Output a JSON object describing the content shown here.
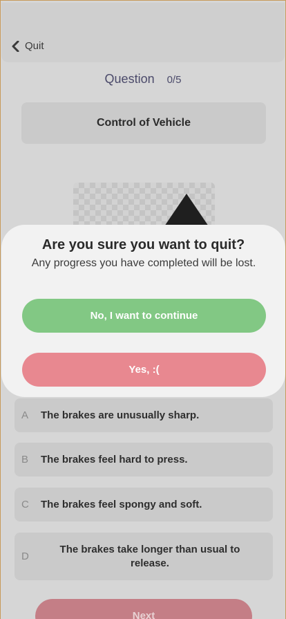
{
  "header": {
    "quit_label": "Quit"
  },
  "progress": {
    "label": "Question",
    "value": "0/5"
  },
  "category": "Control of Vehicle",
  "answers": [
    {
      "letter": "A",
      "text": "The brakes are unusually sharp."
    },
    {
      "letter": "B",
      "text": "The brakes feel hard to press."
    },
    {
      "letter": "C",
      "text": "The brakes feel spongy and soft."
    },
    {
      "letter": "D",
      "text": "The brakes take longer than usual to release."
    }
  ],
  "next_label": "Next",
  "modal": {
    "title": "Are you sure you want to quit?",
    "message": "Any progress you have completed will be lost.",
    "continue_label": "No, I want to continue",
    "quit_label": "Yes, :("
  },
  "colors": {
    "continue": "#82c884",
    "quit": "#e88890",
    "next": "#c47e86"
  }
}
